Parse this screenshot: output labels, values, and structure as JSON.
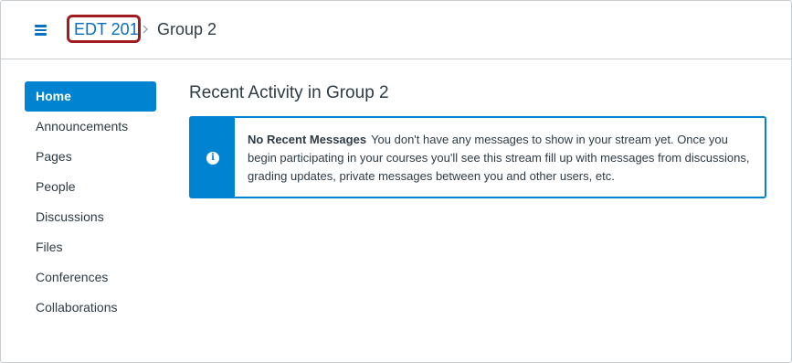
{
  "header": {
    "menu_icon": "hamburger-icon",
    "breadcrumb": {
      "course_link": "EDT 201",
      "separator_icon": "chevron-right-icon",
      "current": "Group 2"
    },
    "highlight_color": "#a11c20"
  },
  "sidebar": {
    "items": [
      {
        "label": "Home",
        "active": true
      },
      {
        "label": "Announcements"
      },
      {
        "label": "Pages"
      },
      {
        "label": "People"
      },
      {
        "label": "Discussions"
      },
      {
        "label": "Files"
      },
      {
        "label": "Conferences"
      },
      {
        "label": "Collaborations"
      }
    ]
  },
  "main": {
    "title": "Recent Activity in Group 2",
    "alert": {
      "icon": "info-icon",
      "heading": "No Recent Messages",
      "body": "You don't have any messages to show in your stream yet. Once you begin participating in your courses you'll see this stream fill up with messages from discussions, grading updates, private messages between you and other users, etc."
    }
  },
  "colors": {
    "accent": "#0084d1",
    "link": "#0770c1",
    "text": "#2d3b45",
    "border": "#c7cdd1"
  }
}
